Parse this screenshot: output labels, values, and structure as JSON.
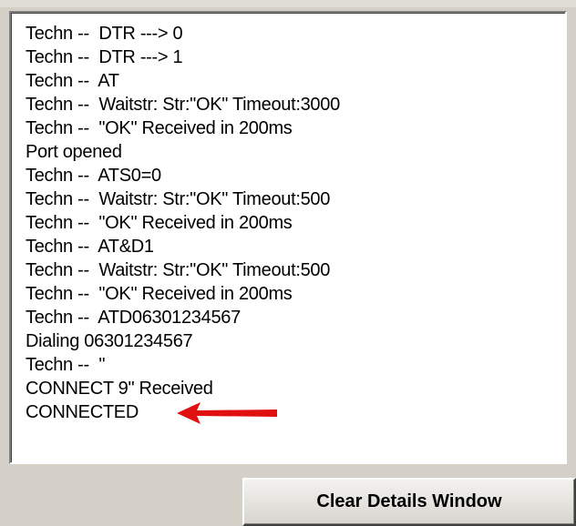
{
  "log": {
    "lines": [
      "Techn --  DTR ---> 0",
      "Techn --  DTR ---> 1",
      "Techn --  AT",
      "Techn --  Waitstr: Str:\"OK\" Timeout:3000",
      "Techn --  \"OK\" Received in 200ms",
      "Port opened",
      "Techn --  ATS0=0",
      "Techn --  Waitstr: Str:\"OK\" Timeout:500",
      "Techn --  \"OK\" Received in 200ms",
      "Techn --  AT&D1",
      "Techn --  Waitstr: Str:\"OK\" Timeout:500",
      "Techn --  \"OK\" Received in 200ms",
      "Techn --  ATD06301234567",
      "Dialing 06301234567",
      "Techn --  \"",
      "CONNECT 9\" Received",
      "CONNECTED"
    ]
  },
  "annotation": {
    "arrow_color": "#e01010",
    "arrow_icon": "left-arrow-icon"
  },
  "controls": {
    "clear_button_label": "Clear Details Window"
  }
}
